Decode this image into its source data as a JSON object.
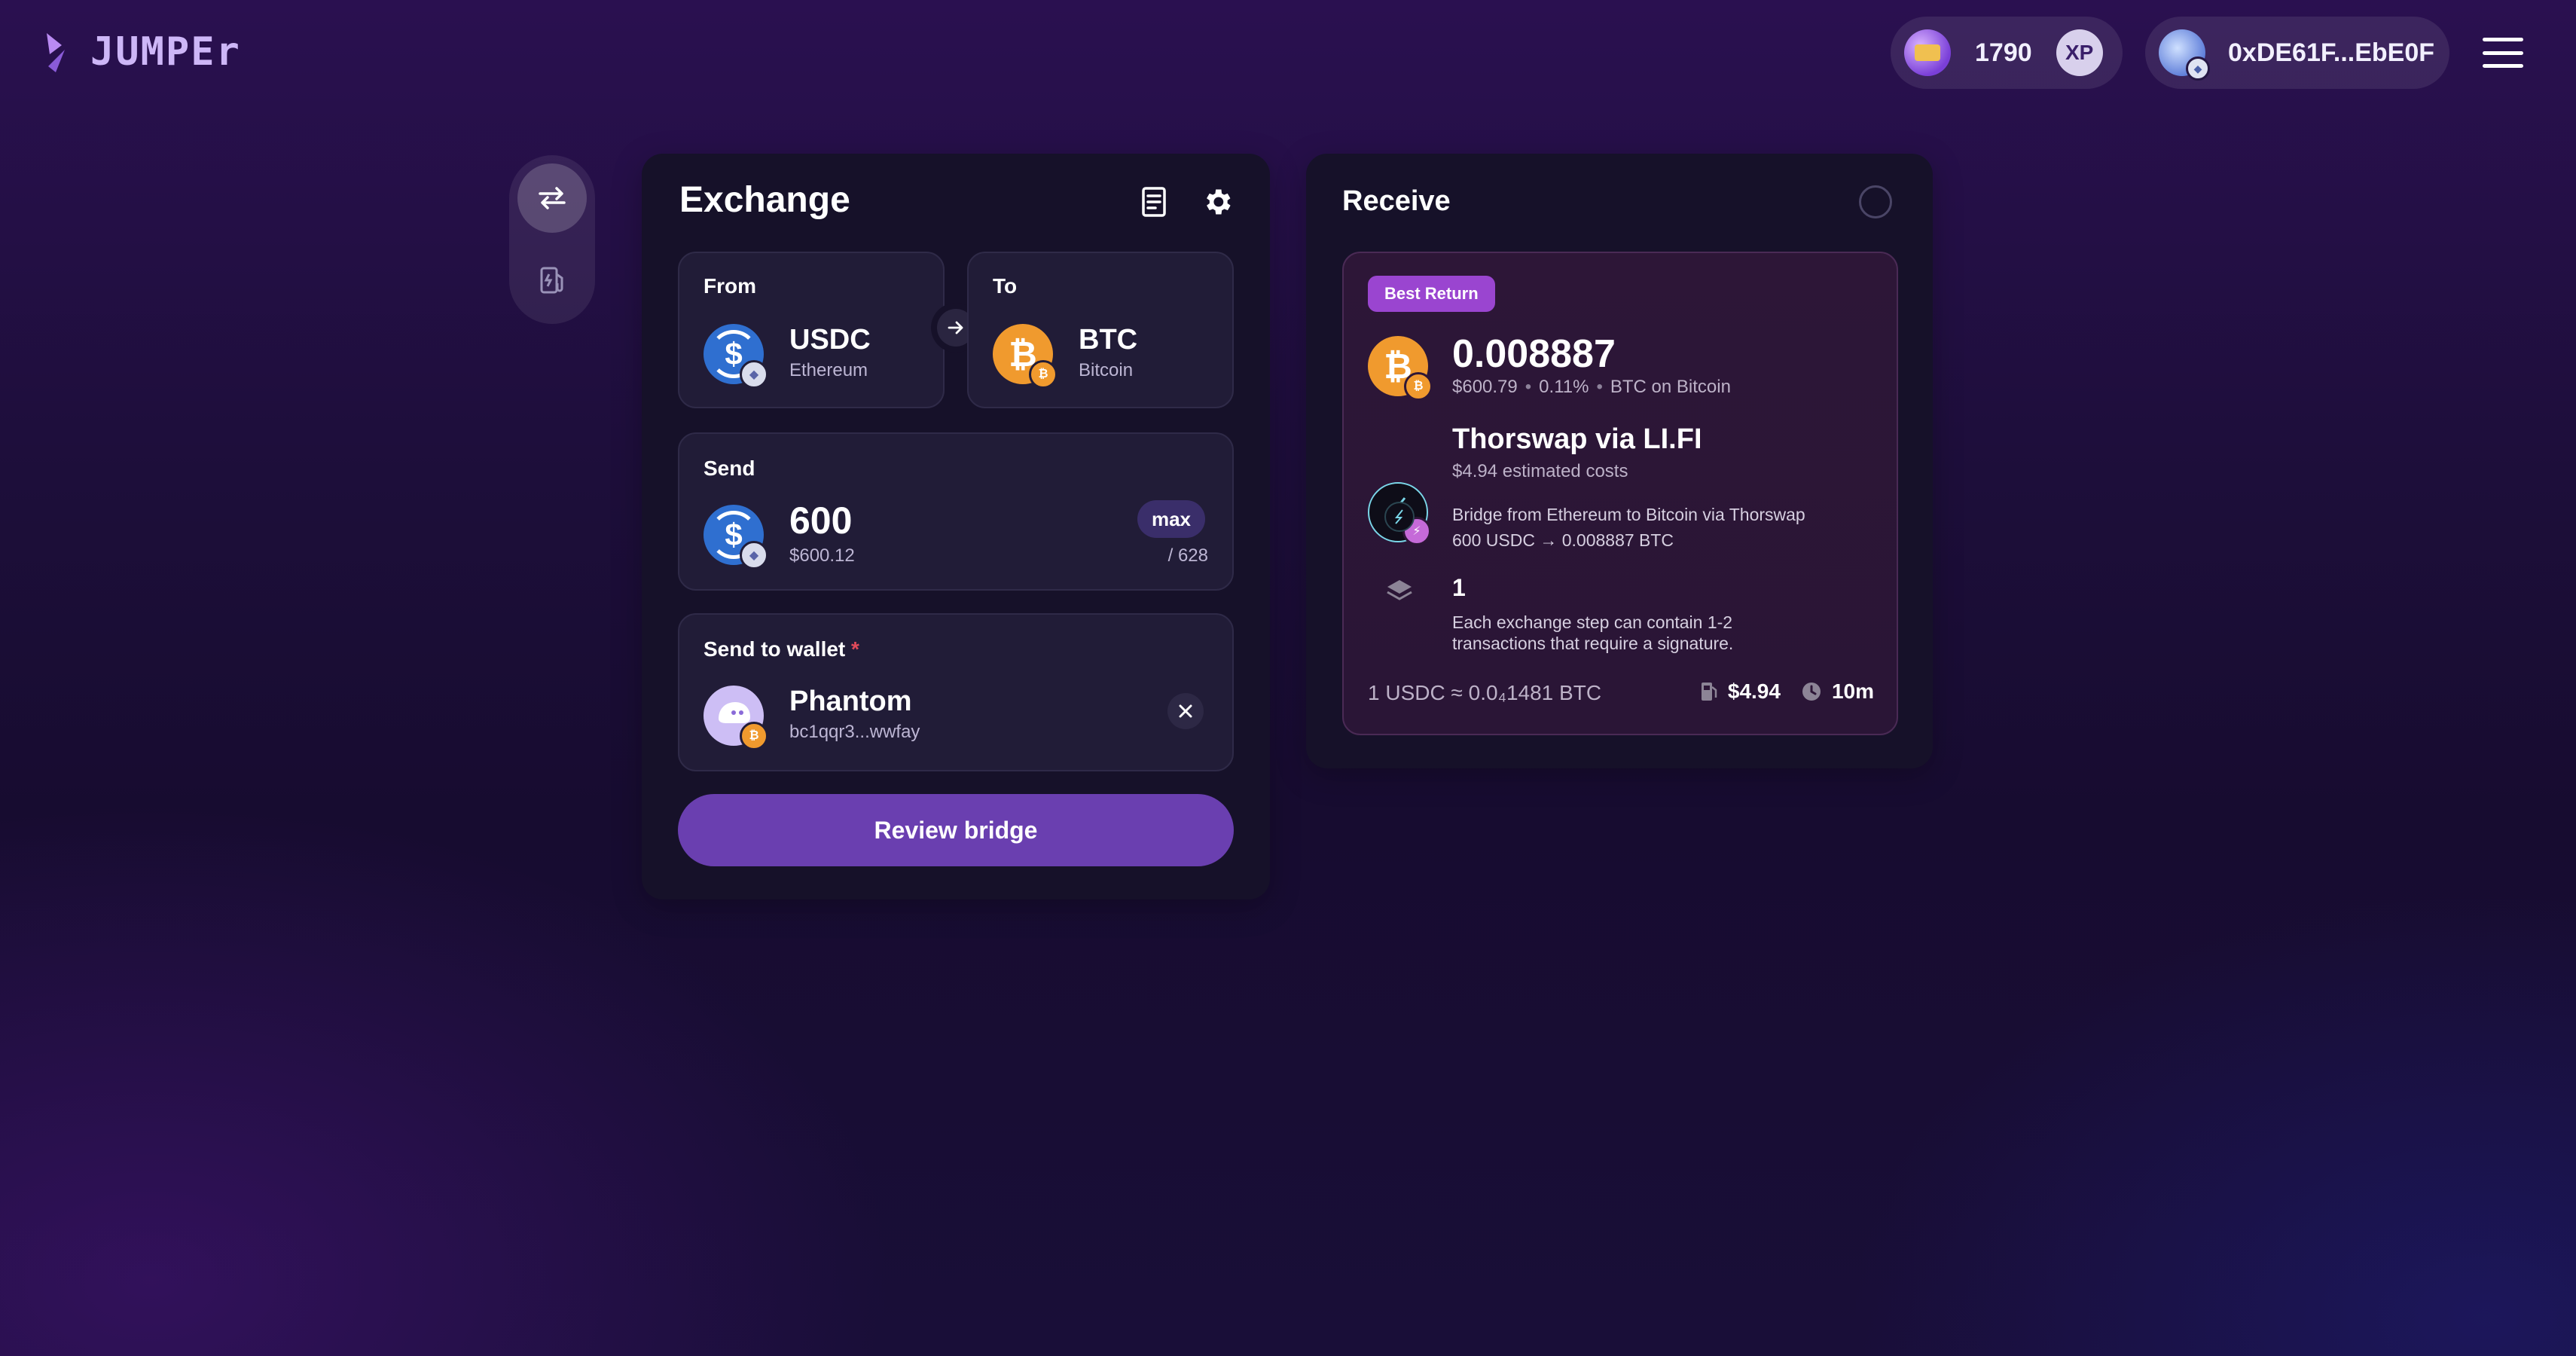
{
  "header": {
    "logo_text": "JUMPEr",
    "xp": {
      "value": "1790",
      "badge": "XP"
    },
    "wallet": {
      "address": "0xDE61F...EbE0F"
    }
  },
  "exchange": {
    "title": "Exchange",
    "from": {
      "label": "From",
      "token": "USDC",
      "chain": "Ethereum"
    },
    "to": {
      "label": "To",
      "token": "BTC",
      "chain": "Bitcoin"
    },
    "send": {
      "label": "Send",
      "amount": "600",
      "usd": "$600.12",
      "max_label": "max",
      "balance": "/ 628"
    },
    "wallet": {
      "label": "Send to wallet",
      "required_mark": "*",
      "name": "Phantom",
      "address": "bc1qqr3...wwfay"
    },
    "review_button": "Review bridge"
  },
  "receive": {
    "title": "Receive",
    "badge": "Best Return",
    "amount": "0.008887",
    "usd": "$600.79",
    "impact": "0.11%",
    "network_text": "BTC on Bitcoin",
    "provider": "Thorswap via LI.FI",
    "provider_cost": "$4.94 estimated costs",
    "step_text": "Bridge from Ethereum to Bitcoin via Thorswap",
    "step_amounts": "600 USDC → 0.008887 BTC",
    "steps_count": "1",
    "steps_note": "Each exchange step can contain 1-2 transactions that require a signature.",
    "rate_text": "1 USDC ≈ 0.0₄1481 BTC",
    "gas_cost": "$4.94",
    "time": "10m"
  },
  "colors": {
    "accent": "#6a3fb0",
    "badge": "#9a45d0",
    "btc": "#f09a2e",
    "usdc": "#2f6fd0"
  }
}
